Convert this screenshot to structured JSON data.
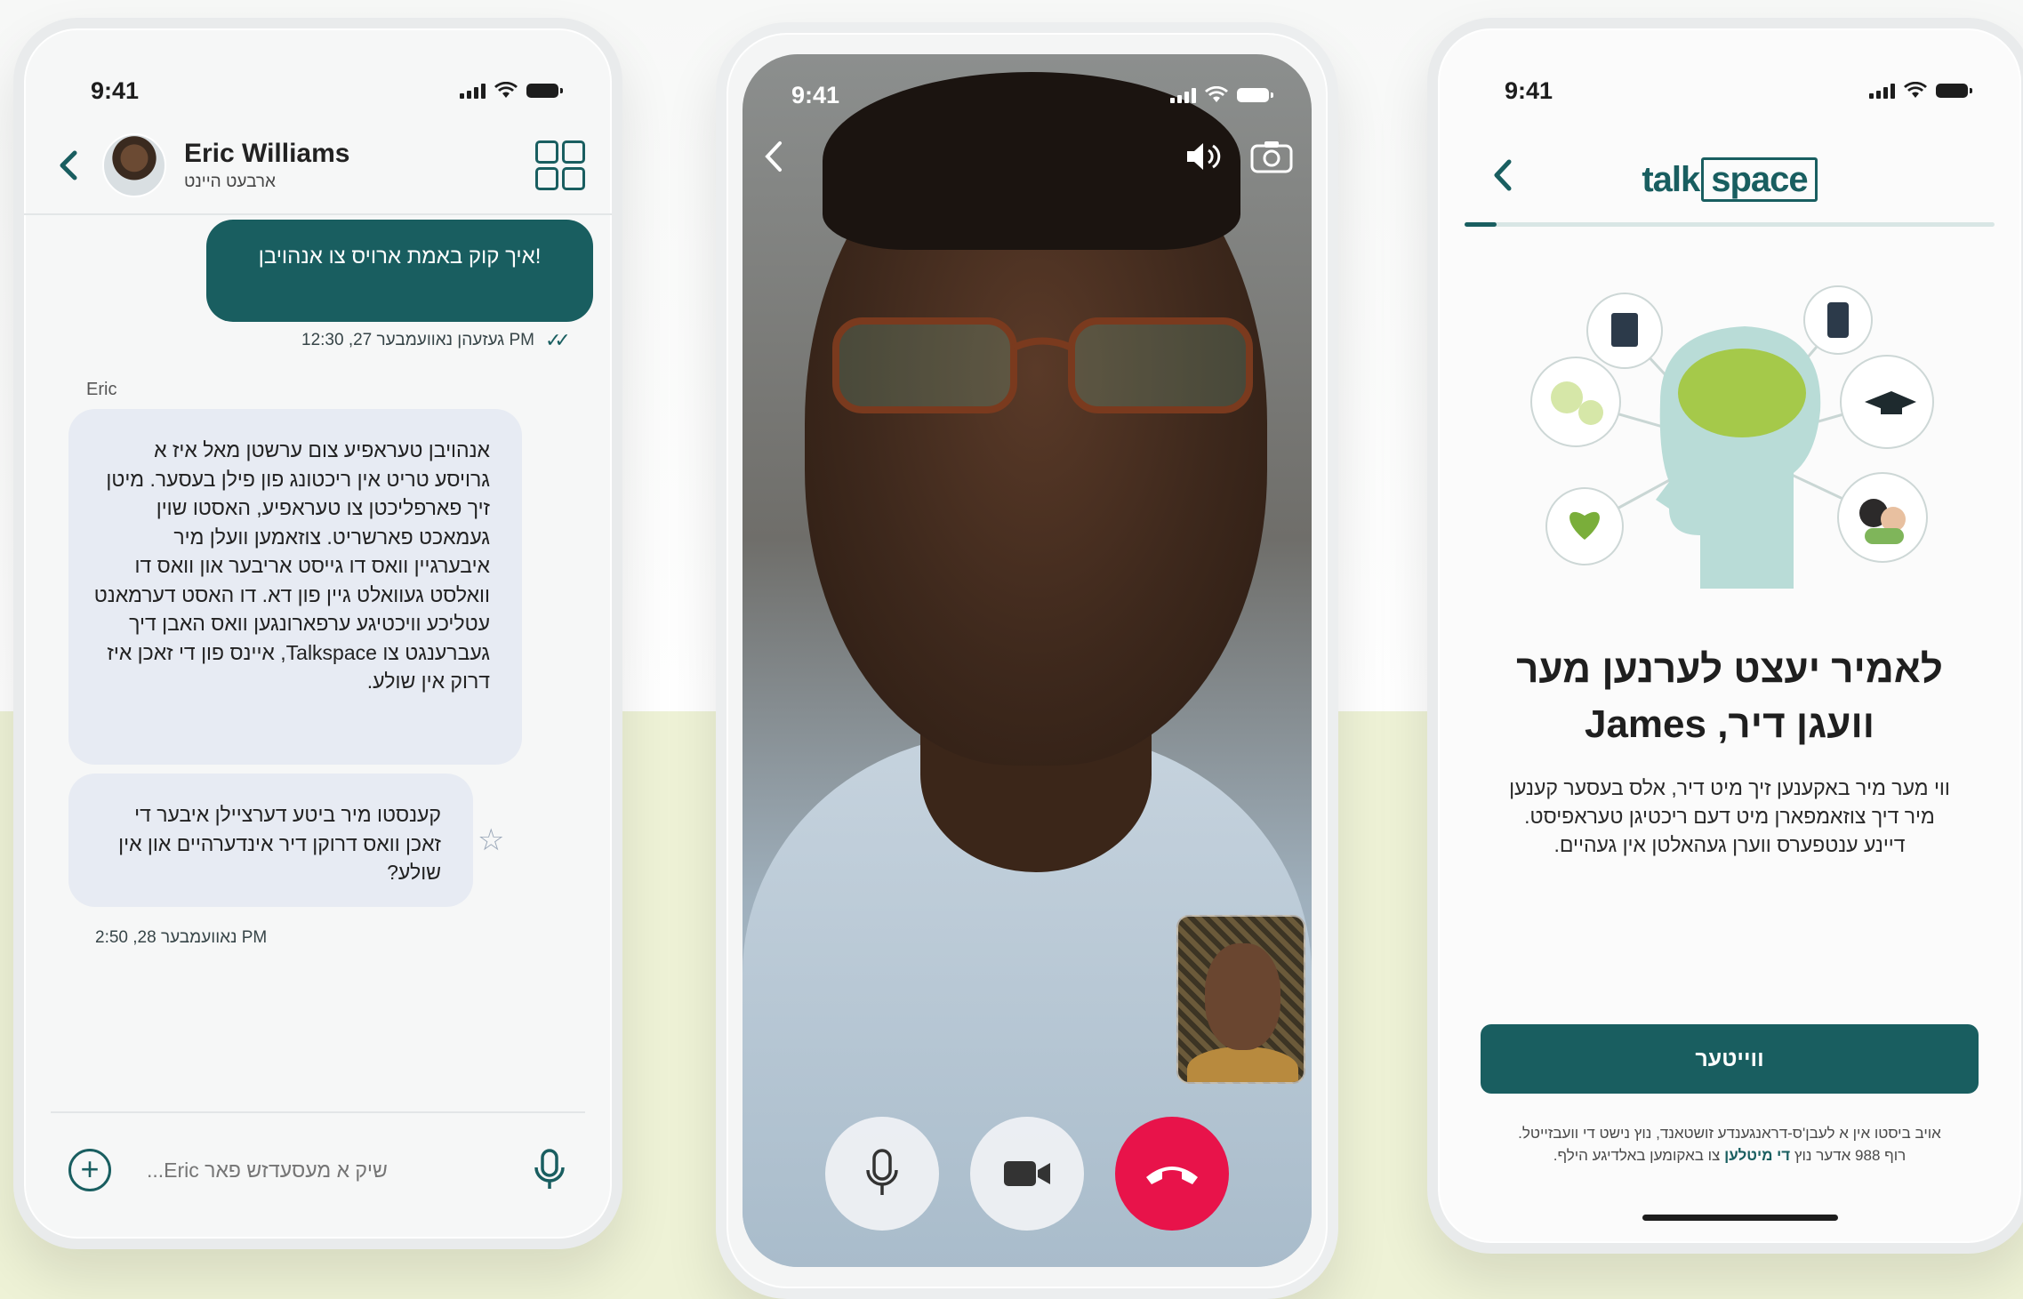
{
  "colors": {
    "brand": "#195e60",
    "end_call": "#e8134a",
    "bubble_in": "#e7ebf3",
    "band": "#eef2d6"
  },
  "chat": {
    "time": "9:41",
    "contact_name": "Eric Williams",
    "contact_status": "ארבעט היינט",
    "outgoing_message": "!איך קוק באמת ארויס צו אנהויבן",
    "outgoing_meta": "געזעהן נאוועמבער 27, 12:30 PM",
    "sender": "Eric",
    "incoming_message_1": "אנהויבן טעראפיע צום ערשטן מאל איז א גרויסע טריט אין ריכטונג פון פילן בעסער. מיטן זיך פארפליכטן צו טעראפיע, האסטו שוין געמאכט פארשריט. צוזאמען וועלן מיר איבערגיין וואס דו גייסט אריבער און וואס דו וואלסט געוואלט גיין פון דא. דו האסט דערמאנט עטליכע וויכטיגע ערפארונגען וואס האבן דיך געברענגט צו Talkspace, איינס פון די זאכן איז דרוק אין שולע.",
    "incoming_message_2": "קענסטו מיר ביטע דערציילן איבער די זאכן וואס דרוקן דיר אינדערהיים און אין שולע?",
    "incoming_meta": "נאוועמבער 28, 2:50 PM",
    "composer_placeholder": "שיק א מעסעדזש פאר Eric...",
    "icons": [
      "back-chevron-icon",
      "avatar",
      "booking-grid-icon",
      "star-icon",
      "plus-icon",
      "microphone-icon"
    ]
  },
  "video": {
    "time": "9:41",
    "icons": [
      "back-chevron-icon",
      "speaker-icon",
      "flip-camera-icon",
      "microphone-icon",
      "video-camera-icon",
      "end-call-icon"
    ]
  },
  "onboarding": {
    "time": "9:41",
    "logo_part1": "talk",
    "logo_part2": "space",
    "progress": 0.06,
    "title_line1": "לאמיר יעצט לערנען מער",
    "title_line2": "וועגן דיר, James",
    "body": "ווי מער מיר באקענען זיך מיט דיר, אלס בעסער קענען מיר דיך צוזאמפארן מיט דעם ריכטיגן טעראפיסט. דיינע ענטפערס ווערן געהאלטן אין געהיים.",
    "button_label": "ווייטער",
    "footer_part1": "אויב ביסטו אין א לעבן'ס-דראנגענדע זושטאנד, נוץ נישט די וועבזייטל.",
    "footer_part2": "רוף 988 אדער נוץ",
    "footer_link": "די מיטלען",
    "footer_part3": "צו באקומען באלדיגע הילף."
  }
}
